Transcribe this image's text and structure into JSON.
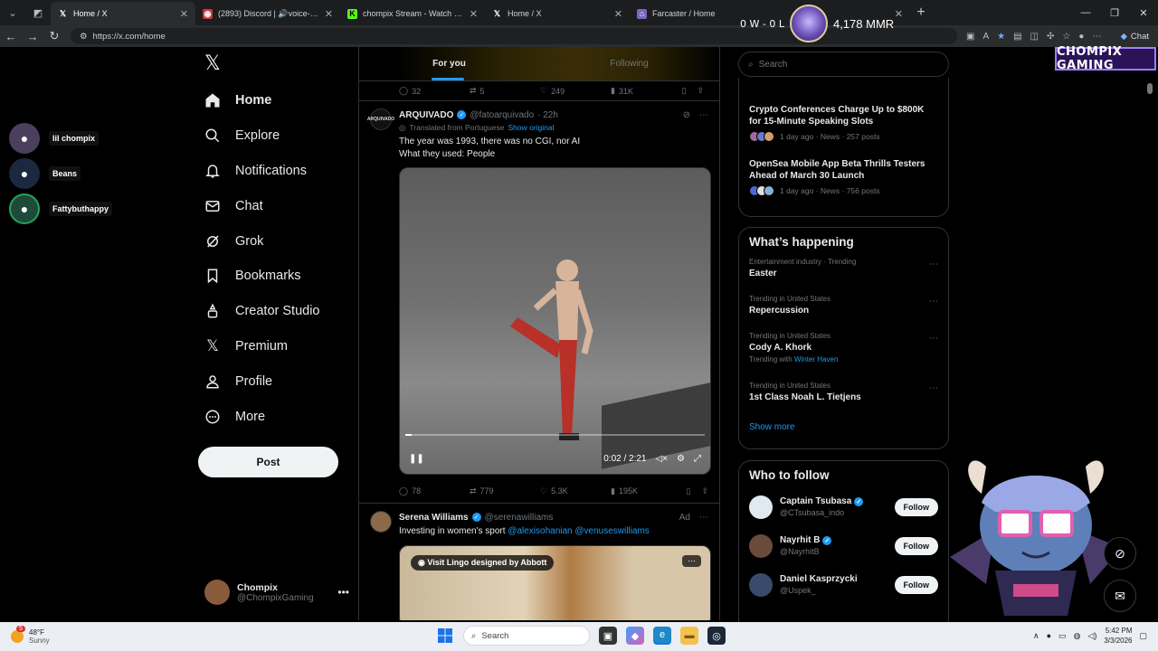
{
  "browser": {
    "tabs": [
      {
        "title": "Home / X",
        "active": true,
        "icon": "x-icon"
      },
      {
        "title": "(2893) Discord | 🔊voice-lilnoune",
        "active": false,
        "icon": "discord-icon"
      },
      {
        "title": "chompix Stream - Watch Live on K",
        "active": false,
        "icon": "kick-icon"
      },
      {
        "title": "Home / X",
        "active": false,
        "icon": "x-icon"
      },
      {
        "title": "Farcaster / Home",
        "active": false,
        "icon": "farcaster-icon"
      }
    ],
    "url": "https://x.com/home",
    "chat_label": "Chat"
  },
  "overlay": {
    "record": "0 W - 0 L",
    "mmr": "4,178 MMR",
    "brand": "CHOMPIX GAMING"
  },
  "discord": {
    "users": [
      {
        "name": "lil chompix",
        "speaking": false
      },
      {
        "name": "Beans",
        "speaking": false
      },
      {
        "name": "Fattybuthappy",
        "speaking": true
      }
    ]
  },
  "sidebar": {
    "items": [
      {
        "label": "Home",
        "icon": "home-icon"
      },
      {
        "label": "Explore",
        "icon": "search-icon"
      },
      {
        "label": "Notifications",
        "icon": "bell-icon"
      },
      {
        "label": "Chat",
        "icon": "mail-icon"
      },
      {
        "label": "Grok",
        "icon": "grok-icon"
      },
      {
        "label": "Bookmarks",
        "icon": "bookmark-icon"
      },
      {
        "label": "Creator Studio",
        "icon": "creator-icon"
      },
      {
        "label": "Premium",
        "icon": "x-icon"
      },
      {
        "label": "Profile",
        "icon": "person-icon"
      },
      {
        "label": "More",
        "icon": "more-icon"
      }
    ],
    "post_label": "Post",
    "account": {
      "name": "Chompix",
      "handle": "@ChompixGaming"
    }
  },
  "timeline": {
    "tabs": [
      {
        "label": "For you",
        "active": true
      },
      {
        "label": "Following",
        "active": false
      }
    ],
    "top_actions": {
      "replies": "32",
      "reposts": "5",
      "likes": "249",
      "views": "31K"
    },
    "tweet1": {
      "avatar_text": "ARQUIVADO",
      "name": "ARQUIVADO",
      "handle": "@fatoarquivado",
      "time": "· 22h",
      "translated": "Translated from Portuguese",
      "show_original": "Show original",
      "text_line1": "The year was 1993, there was no CGI, nor AI",
      "text_line2": "What they used: People",
      "video_time": "0:02 / 2:21",
      "video_progress_fraction": 0.014,
      "actions": {
        "replies": "78",
        "reposts": "779",
        "likes": "5.3K",
        "views": "195K"
      }
    },
    "tweet2": {
      "name": "Serena Williams",
      "handle": "@serenawilliams",
      "ad_label": "Ad",
      "text": "Investing in women's sport",
      "mention1": "@alexisohanian",
      "mention2": "@venuseswilliams",
      "cta": "Visit Lingo designed by Abbott"
    }
  },
  "right": {
    "search_placeholder": "Search",
    "news": [
      {
        "headline": "Crypto Conferences Charge Up to $800K for 15-Minute Speaking Slots",
        "meta": "1 day ago · News · 257 posts"
      },
      {
        "headline": "OpenSea Mobile App Beta Thrills Testers Ahead of March 30 Launch",
        "meta": "1 day ago · News · 756 posts"
      }
    ],
    "happening_title": "What’s happening",
    "trends": [
      {
        "context": "Entertainment industry · Trending",
        "topic": "Easter",
        "with": ""
      },
      {
        "context": "Trending in United States",
        "topic": "Repercussion",
        "with": ""
      },
      {
        "context": "Trending in United States",
        "topic": "Cody A. Khork",
        "with_label": "Trending with",
        "with": "Winter Haven"
      },
      {
        "context": "Trending in United States",
        "topic": "1st Class Noah L. Tietjens",
        "with": ""
      }
    ],
    "show_more": "Show more",
    "follow_title": "Who to follow",
    "follow": [
      {
        "name": "Captain Tsubasa",
        "handle": "@CTsubasa_indo",
        "button": "Follow"
      },
      {
        "name": "Nayrhit B",
        "handle": "@NayrhitB",
        "button": "Follow"
      },
      {
        "name": "Daniel Kasprzycki",
        "handle": "@Uspek_",
        "button": "Follow"
      }
    ]
  },
  "taskbar": {
    "temp": "48°F",
    "condition": "Sunny",
    "weather_badge": "5",
    "search": "Search",
    "time": "5:42 PM",
    "date": "3/3/2026"
  }
}
